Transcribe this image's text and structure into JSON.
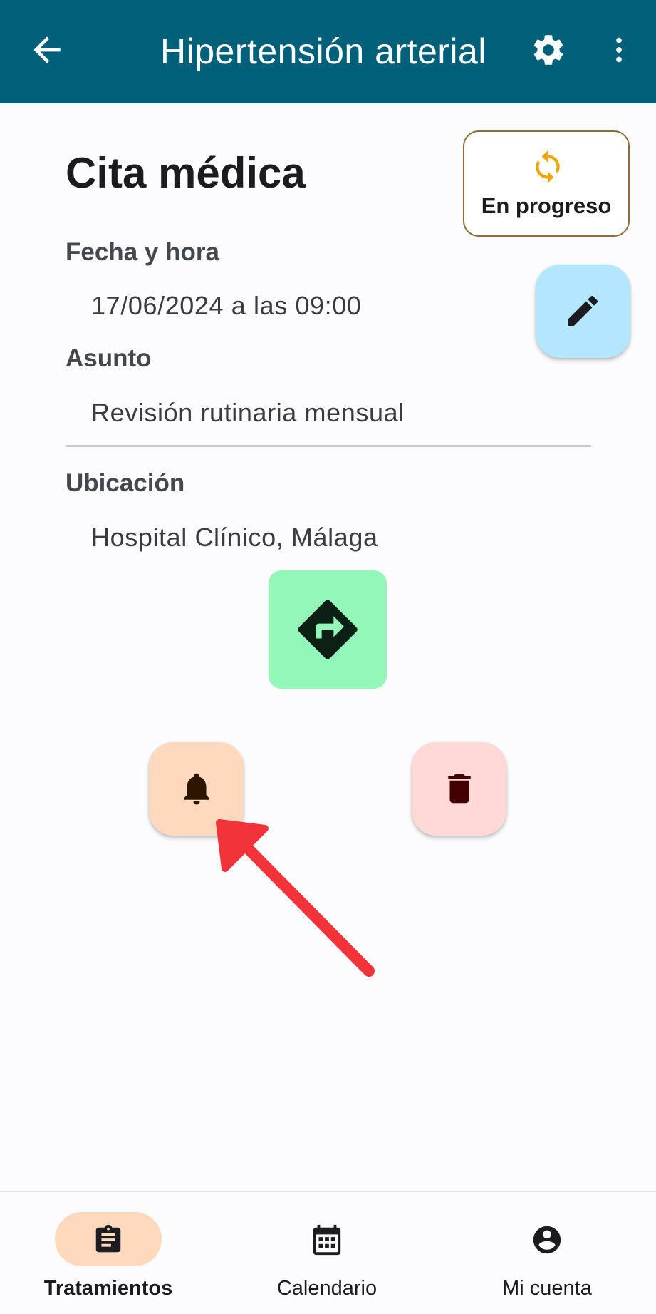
{
  "appbar": {
    "title": "Hipertensión arterial",
    "back_icon": "arrow-left-icon",
    "settings_icon": "gear-icon",
    "more_icon": "more-vert-icon",
    "background": "#00607a"
  },
  "appointment": {
    "heading": "Cita médica",
    "status": {
      "label": "En progreso",
      "icon": "sync-icon",
      "icon_color": "#f0a400"
    },
    "fields": [
      {
        "label": "Fecha y hora",
        "value": "17/06/2024 a las 09:00"
      },
      {
        "label": "Asunto",
        "value": "Revisión rutinaria mensual"
      },
      {
        "label": "Ubicación",
        "value": "Hospital Clínico, Málaga"
      }
    ]
  },
  "actions": {
    "edit_icon": "pencil-icon",
    "directions_icon": "directions-icon",
    "reminder_icon": "bell-icon",
    "delete_icon": "trash-icon",
    "colors": {
      "edit": "#b3e7ff",
      "directions": "#92f7b8",
      "reminder": "#fed9bd",
      "delete": "#fed9d6"
    }
  },
  "annotation": {
    "type": "arrow",
    "color": "#f2333a",
    "points_to": "reminder"
  },
  "bottom_nav": {
    "items": [
      {
        "label": "Tratamientos",
        "icon": "clipboard-icon",
        "active": true
      },
      {
        "label": "Calendario",
        "icon": "calendar-icon",
        "active": false
      },
      {
        "label": "Mi cuenta",
        "icon": "account-circle-icon",
        "active": false
      }
    ]
  }
}
